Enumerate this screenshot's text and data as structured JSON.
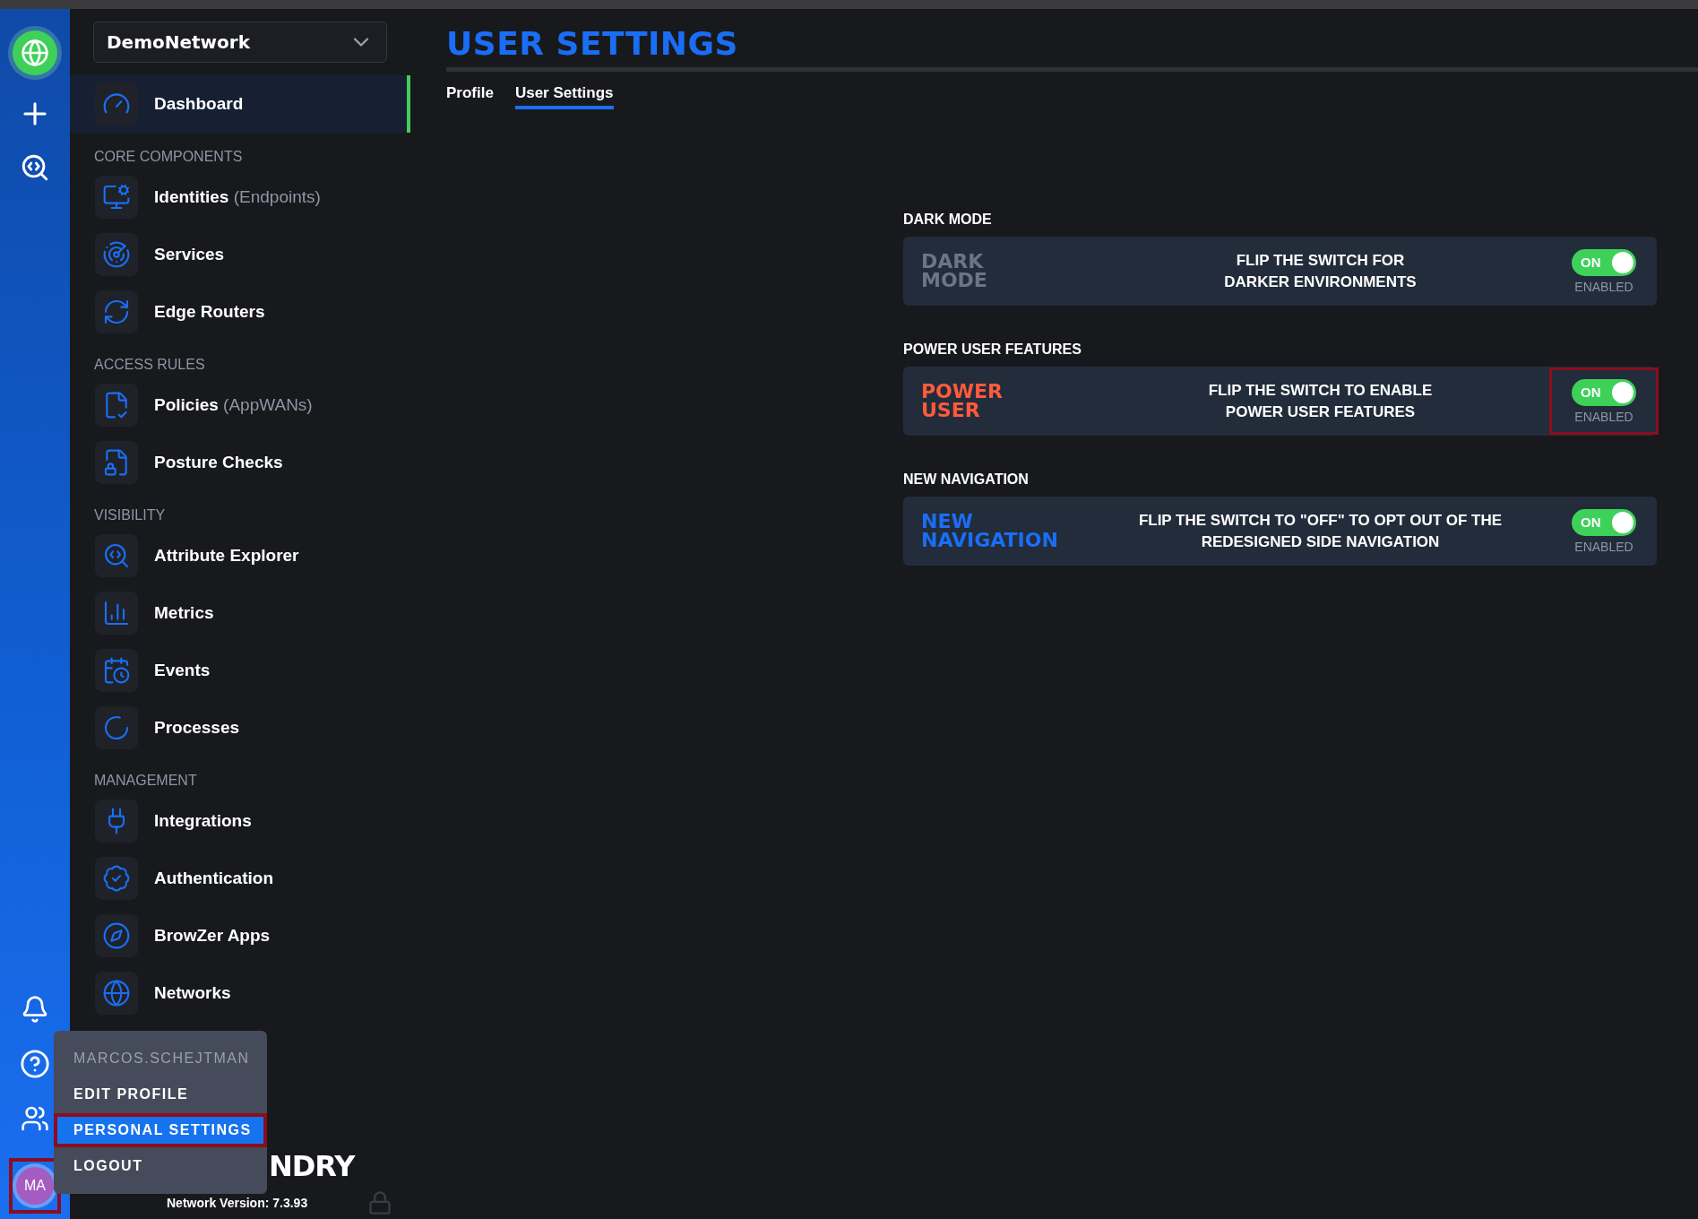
{
  "rail": {
    "avatar": {
      "initials": "MA",
      "highlighted": true
    }
  },
  "network_selector": {
    "value": "DemoNetwork"
  },
  "sidebar": {
    "groups": [
      {
        "items": [
          {
            "label": "Dashboard",
            "selected": true
          }
        ]
      },
      {
        "heading": "CORE COMPONENTS",
        "items": [
          {
            "label": "Identities",
            "note": "(Endpoints)",
            "selected": false
          },
          {
            "label": "Services",
            "selected": false
          },
          {
            "label": "Edge Routers",
            "selected": false
          }
        ]
      },
      {
        "heading": "ACCESS RULES",
        "items": [
          {
            "label": "Policies",
            "note": "(AppWANs)",
            "selected": false
          },
          {
            "label": "Posture Checks",
            "selected": false
          }
        ]
      },
      {
        "heading": "VISIBILITY",
        "items": [
          {
            "label": "Attribute Explorer",
            "selected": false
          },
          {
            "label": "Metrics",
            "selected": false
          },
          {
            "label": "Events",
            "selected": false
          },
          {
            "label": "Processes",
            "selected": false
          }
        ]
      },
      {
        "heading": "MANAGEMENT",
        "items": [
          {
            "label": "Integrations",
            "selected": false
          },
          {
            "label": "Authentication",
            "selected": false
          },
          {
            "label": "BrowZer Apps",
            "selected": false
          },
          {
            "label": "Networks",
            "selected": false
          }
        ]
      }
    ],
    "logo": "NDRY",
    "version": "Network Version: 7.3.93"
  },
  "user_menu": {
    "username": "MARCOS.SCHEJTMAN",
    "items": [
      {
        "label": "EDIT PROFILE",
        "selected": false,
        "highlighted": false
      },
      {
        "label": "PERSONAL SETTINGS",
        "selected": true,
        "highlighted": true
      },
      {
        "label": "LOGOUT",
        "selected": false,
        "highlighted": false
      }
    ]
  },
  "page": {
    "title": "USER SETTINGS",
    "tabs": [
      {
        "label": "Profile",
        "selected": false
      },
      {
        "label": "User Settings",
        "selected": true
      }
    ]
  },
  "settings": [
    {
      "section": "DARK MODE",
      "title_lines": [
        "DARK",
        "MODE"
      ],
      "color": "#6b7587",
      "description_lines": [
        "FLIP THE SWITCH FOR",
        "DARKER ENVIRONMENTS"
      ],
      "toggle": {
        "on": true,
        "label": "ON",
        "status": "ENABLED",
        "highlighted": false
      }
    },
    {
      "section": "POWER USER FEATURES",
      "title_lines": [
        "POWER",
        "USER"
      ],
      "color": "#ff5a3c",
      "description_lines": [
        "FLIP THE SWITCH TO ENABLE",
        "POWER USER FEATURES"
      ],
      "toggle": {
        "on": true,
        "label": "ON",
        "status": "ENABLED",
        "highlighted": true
      }
    },
    {
      "section": "NEW NAVIGATION",
      "title_lines": [
        "NEW",
        "NAVIGATION"
      ],
      "color": "#1a6ef5",
      "description_lines": [
        "FLIP THE SWITCH TO \"OFF\" TO OPT OUT OF THE",
        "REDESIGNED SIDE NAVIGATION"
      ],
      "toggle": {
        "on": true,
        "label": "ON",
        "status": "ENABLED",
        "highlighted": false
      }
    }
  ]
}
